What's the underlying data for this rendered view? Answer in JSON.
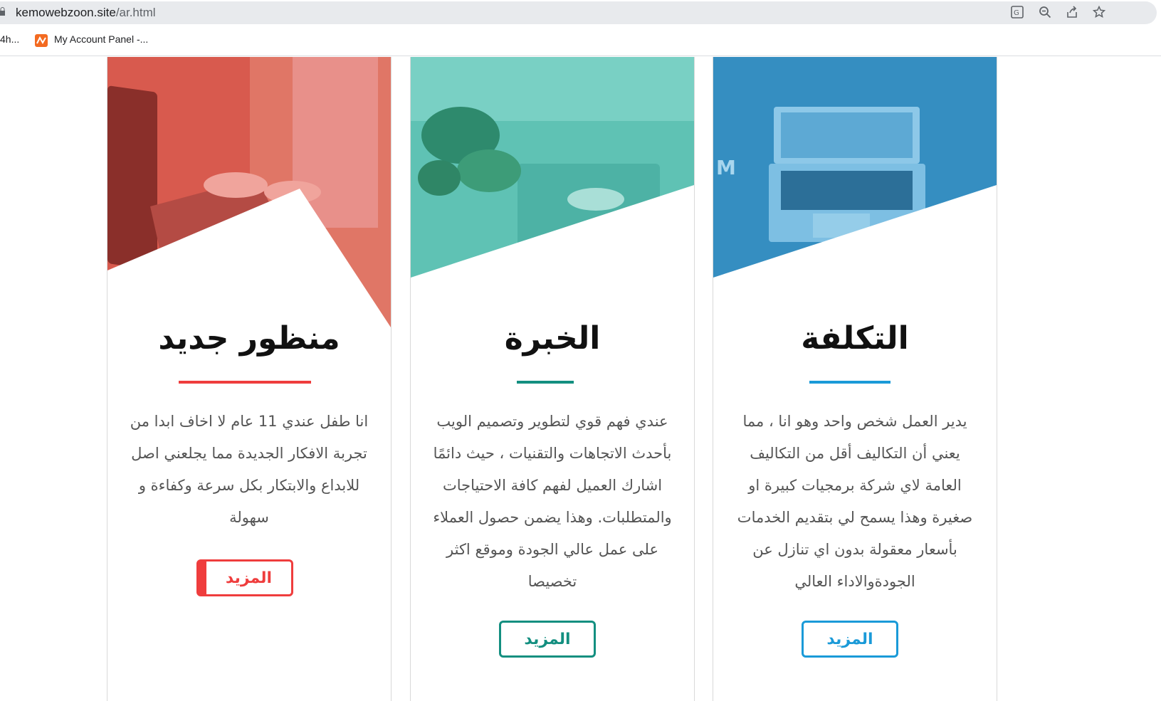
{
  "browser": {
    "url_domain": "kemowebzoon.site",
    "url_path": "/ar.html",
    "bookmarks": [
      "4h...",
      "My Account Panel -..."
    ],
    "icons": [
      "translate-icon",
      "zoom-icon",
      "share-icon",
      "bookmark-star-icon"
    ]
  },
  "cards": [
    {
      "title": "منظور جديد",
      "text": "انا طفل عندي 11 عام لا اخاف ابدا من تجربة الافكار الجديدة مما يجلعني اصل للابداع والابتكار بكل سرعة وكفاءة و سهولة",
      "button": "المزيد",
      "accent": "#ef3d3d"
    },
    {
      "title": "الخبرة",
      "text": "عندي فهم قوي لتطوير وتصميم الويب بأحدث الاتجاهات والتقنيات ، حيث دائمًا اشارك العميل لفهم كافة الاحتياجات والمتطلبات. وهذا يضمن حصول العملاء على عمل عالي الجودة وموقع اكثر تخصيصا",
      "button": "المزيد",
      "accent": "#138f80"
    },
    {
      "title": "التكلفة",
      "text": "يدير العمل شخص واحد وهو انا ، مما يعني أن التكاليف أقل من التكاليف العامة لاي شركة برمجيات كبيرة او صغيرة وهذا يسمح لي بتقديم الخدمات بأسعار معقولة بدون اي تنازل عن الجودةوالاداء العالي",
      "button": "المزيد",
      "accent": "#1a9ad8"
    }
  ]
}
